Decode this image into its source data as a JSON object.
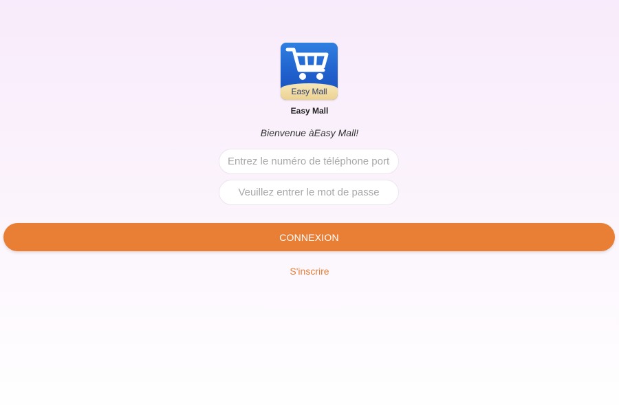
{
  "app": {
    "icon": "shopping-cart-icon",
    "icon_banner_text": "Easy Mall",
    "name": "Easy Mall",
    "welcome": "Bienvenue àEasy Mall!"
  },
  "form": {
    "phone_placeholder": "Entrez le numéro de téléphone portable",
    "password_placeholder": "Veuillez entrer le mot de passe",
    "login_label": "CONNEXION",
    "register_label": "S'inscrire"
  },
  "colors": {
    "accent": "#e97e35",
    "icon_blue": "#1f5fcc",
    "icon_banner": "#ecd290"
  }
}
